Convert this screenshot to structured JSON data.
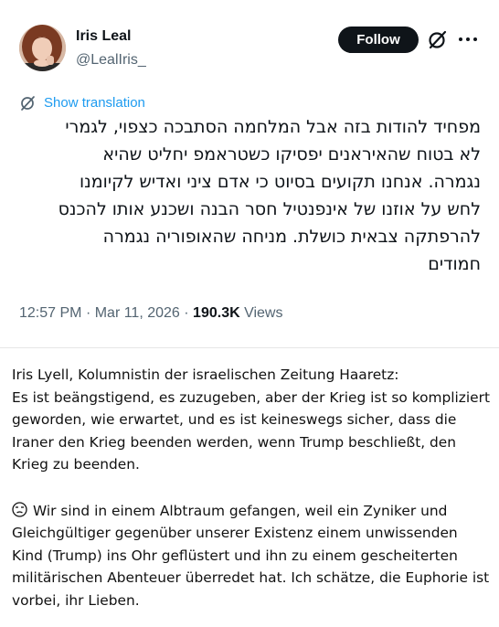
{
  "author": {
    "name": "Iris Leal",
    "handle": "@LealIris_"
  },
  "actions": {
    "follow_label": "Follow"
  },
  "icons": {
    "grok": "grok-slash-icon",
    "more": "more-horizontal-icon",
    "translate": "translate-icon",
    "emoji": "unamused-face-emoji"
  },
  "colors": {
    "link": "#1d9bf0",
    "secondary_text": "#536471",
    "follow_bg": "#0f1419"
  },
  "tweet": {
    "translation_label": "Show translation",
    "text_lines": [
      "מפחיד להודות בזה אבל המלחמה הסתבכה כצפוי, לגמרי",
      "לא בטוח שהאיראנים יפסיקו כשטראמפ יחליט שהיא",
      "נגמרה. אנחנו תקועים בסיוט כי אדם ציני ואדיש לקיומנו",
      "לחש על אוזנו של אינפנטיל חסר הבנה ושכנע אותו להכנס",
      "להרפתקה צבאית כושלת. מניחה שהאופוריה נגמרה",
      "חמודים"
    ],
    "time": "12:57 PM",
    "date": "Mar 11, 2026",
    "separator": "·",
    "views_count": "190.3K",
    "views_label": "Views"
  },
  "caption": {
    "paragraph1_lines": [
      "Iris Lyell, Kolumnistin der israelischen Zeitung Haaretz:",
      "Es ist beängstigend, es zuzugeben, aber der Krieg ist so kompliziert",
      "geworden, wie erwartet, und es ist keineswegs sicher, dass die",
      "Iraner den Krieg beenden werden, wenn Trump beschließt, den",
      "Krieg zu beenden."
    ],
    "paragraph2_first": "Wir sind in einem Albtraum gefangen, weil ein Zyniker und",
    "paragraph2_lines": [
      "Gleichgültiger gegenüber unserer Existenz einem unwissenden",
      "Kind (Trump) ins Ohr geflüstert und ihn zu einem gescheiterten",
      "militärischen Abenteuer überredet hat. Ich schätze, die Euphorie ist",
      "vorbei, ihr Lieben."
    ]
  }
}
